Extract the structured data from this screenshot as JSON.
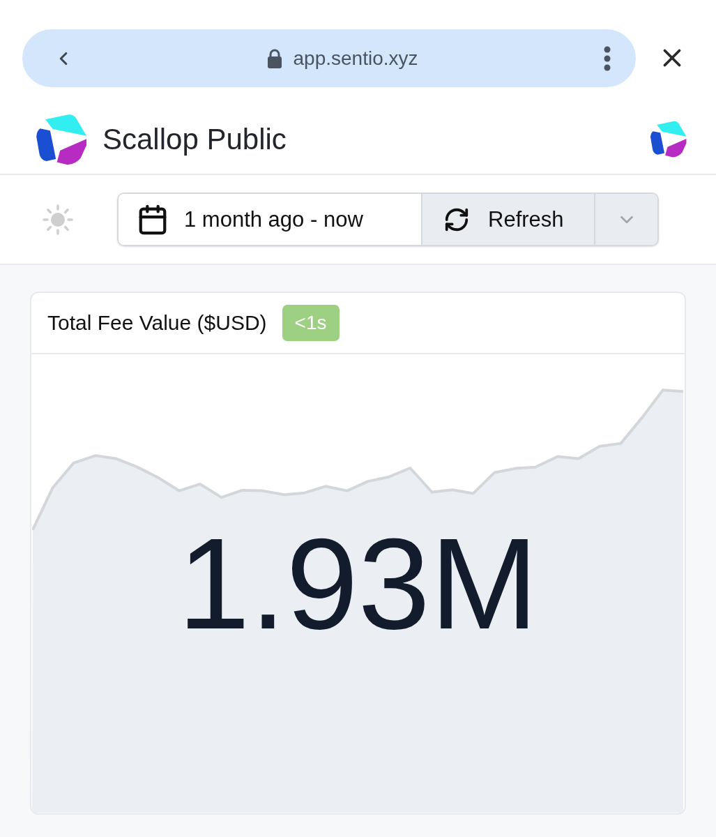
{
  "browser_bar": {
    "url": "app.sentio.xyz"
  },
  "header": {
    "title": "Scallop Public"
  },
  "toolbar": {
    "date_range": "1 month ago - now",
    "refresh": "Refresh"
  },
  "card": {
    "title": "Total Fee Value ($USD)",
    "badge": "<1s",
    "value": "1.93M"
  }
}
